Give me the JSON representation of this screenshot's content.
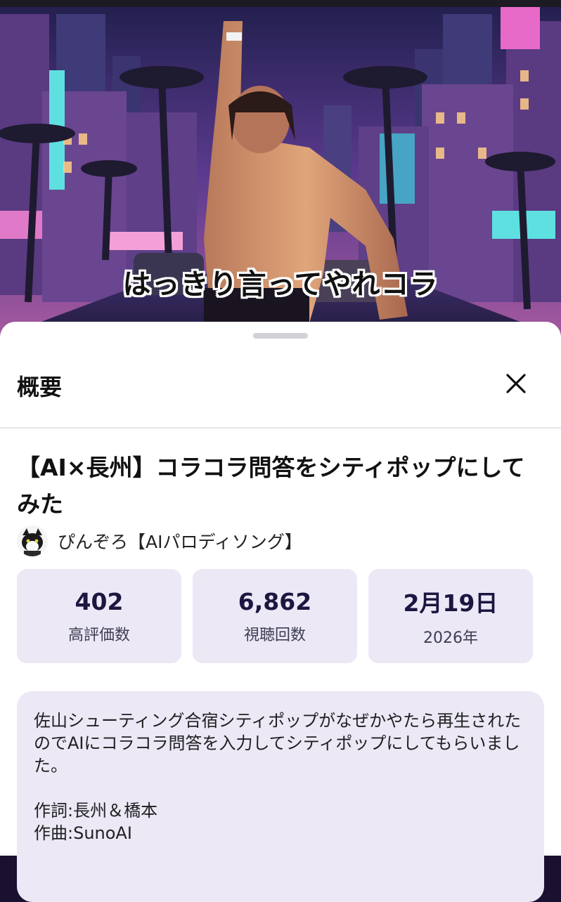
{
  "thumbnail": {
    "caption": "はっきり言ってやれコラ"
  },
  "sheet": {
    "title": "概要",
    "close_icon": "close-icon"
  },
  "video": {
    "title": "【AI×長州】コラコラ問答をシティポップにしてみた",
    "channel_name": "ぴんぞろ【AIパロディソング】",
    "channel_avatar": "cat-avatar-icon"
  },
  "stats": [
    {
      "value": "402",
      "label": "高評価数"
    },
    {
      "value": "6,862",
      "label": "視聴回数"
    },
    {
      "value": "2月19日",
      "label": "2026年"
    }
  ],
  "description": {
    "text": "佐山シューティング合宿シティポップがなぜかやたら再生されたのでAIにコラコラ問答を入力してシティポップにしてもらいました。\n\n作詞:長州＆橋本\n作曲:SunoAI"
  },
  "colors": {
    "stat_card_bg": "#ece8f6",
    "accent_text": "#1c1740"
  }
}
